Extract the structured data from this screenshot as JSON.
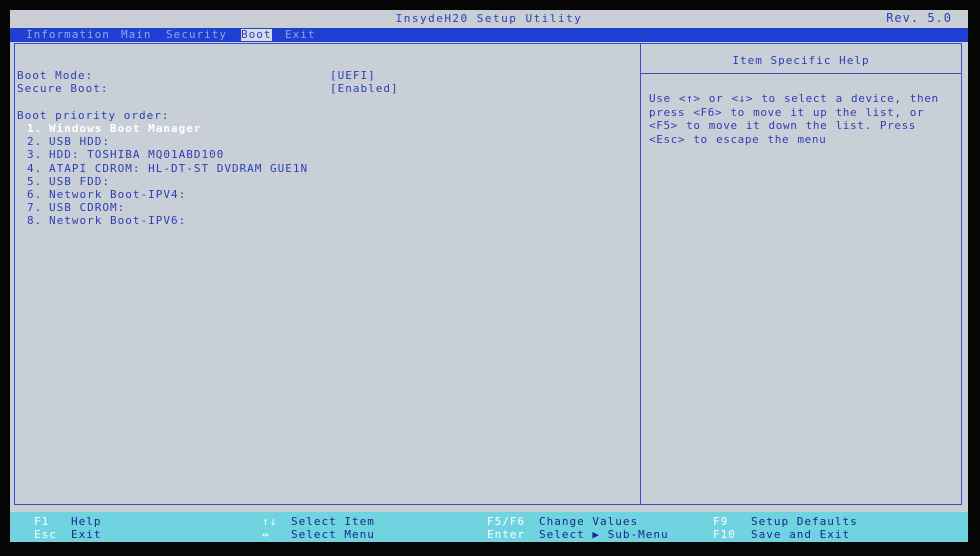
{
  "header": {
    "title": "InsydeH20 Setup Utility",
    "revision": "Rev. 5.0"
  },
  "menu": {
    "items": [
      "Information",
      "Main",
      "Security",
      "Boot",
      "Exit"
    ],
    "active": "Boot"
  },
  "settings": {
    "boot_mode_label": "Boot Mode:",
    "boot_mode_value": "[UEFI]",
    "secure_boot_label": "Secure Boot:",
    "secure_boot_value": "[Enabled]",
    "priority_heading": "Boot priority order:"
  },
  "boot_order": [
    {
      "num": "1.",
      "label": "Windows Boot Manager"
    },
    {
      "num": "2.",
      "label": "USB HDD:"
    },
    {
      "num": "3.",
      "label": "HDD: TOSHIBA MQ01ABD100"
    },
    {
      "num": "4.",
      "label": "ATAPI CDROM: HL-DT-ST DVDRAM GUE1N"
    },
    {
      "num": "5.",
      "label": "USB FDD:"
    },
    {
      "num": "6.",
      "label": "Network Boot-IPV4:"
    },
    {
      "num": "7.",
      "label": "USB CDROM:"
    },
    {
      "num": "8.",
      "label": "Network Boot-IPV6:"
    }
  ],
  "selected_boot_index": 0,
  "help": {
    "title": "Item Specific Help",
    "text": "Use <↑> or <↓> to select a device, then press <F6> to move it up the list, or <F5> to move it down the list. Press <Esc> to escape the menu"
  },
  "footer": {
    "f1_key": "F1",
    "f1_desc": "Help",
    "esc_key": "Esc",
    "esc_desc": "Exit",
    "updown_key": "↑↓",
    "updown_desc": "Select Item",
    "leftright_key": "↔",
    "leftright_desc": "Select Menu",
    "f5f6_key": "F5/F6",
    "f5f6_desc": "Change Values",
    "enter_key": "Enter",
    "enter_desc": "Select ▶ Sub-Menu",
    "f9_key": "F9",
    "f9_desc": "Setup Defaults",
    "f10_key": "F10",
    "f10_desc": "Save and Exit"
  },
  "colors": {
    "screen_bg": "#c9cfd6",
    "menu_bar": "#1f3fd1",
    "text_blue": "#2d3fb6",
    "footer_bg": "#6fd3e0"
  }
}
